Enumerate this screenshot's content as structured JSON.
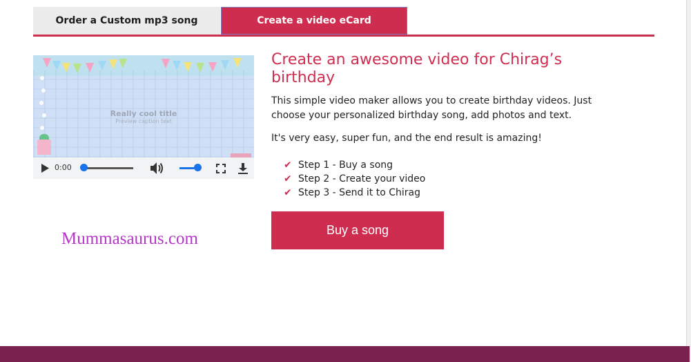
{
  "tabs": [
    {
      "label": "Order a Custom mp3 song",
      "active": false
    },
    {
      "label": "Create a video eCard",
      "active": true
    }
  ],
  "video": {
    "overlay_title": "Really cool title",
    "overlay_caption": "Preview caption text",
    "current_time": "0:00",
    "progress": 0,
    "volume": 0.9,
    "icons": [
      "play-icon",
      "volume-icon",
      "fullscreen-icon",
      "download-icon"
    ]
  },
  "watermark": "Mummasaurus.com",
  "content": {
    "heading": "Create an awesome video for Chirag’s birthday",
    "description": "This simple video maker allows you to create birthday videos. Just choose your personalized birthday song, add photos and text.",
    "tagline": "It's very easy, super fun, and the end result is amazing!",
    "steps": [
      "Step 1 - Buy a song",
      "Step 2 - Create your video",
      "Step 3 - Send it to Chirag"
    ],
    "cta_label": "Buy a song"
  },
  "colors": {
    "accent": "#cf2d4f",
    "footer": "#7a2150",
    "watermark": "#b536c8",
    "player_accent": "#1a73e8"
  }
}
